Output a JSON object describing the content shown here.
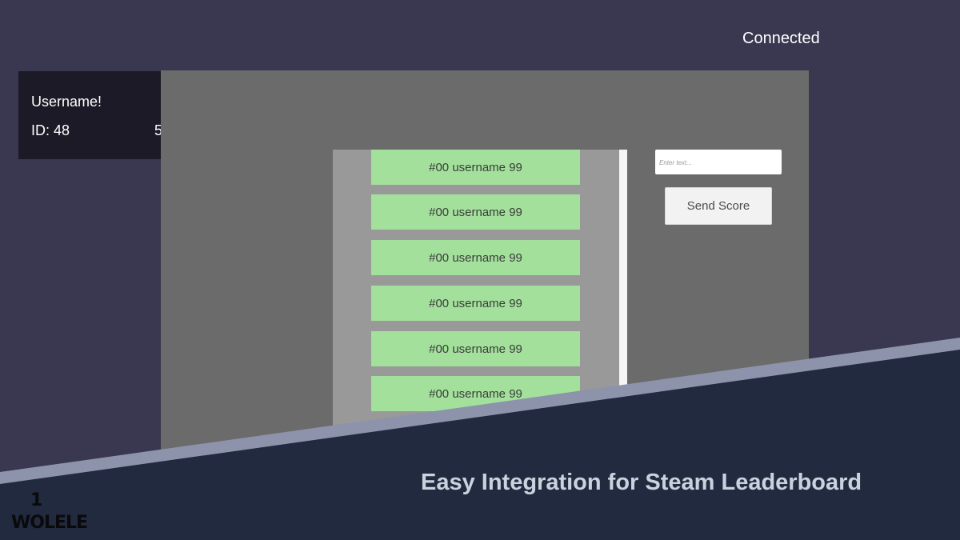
{
  "status": {
    "connection": "Connected"
  },
  "user": {
    "name": "Username!",
    "id": "ID: 48",
    "extra": "5"
  },
  "leaderboard": {
    "rows": [
      {
        "label": "#00 username 99"
      },
      {
        "label": "#00 username 99"
      },
      {
        "label": "#00 username 99"
      },
      {
        "label": "#00 username 99"
      },
      {
        "label": "#00 username 99"
      },
      {
        "label": "#00 username 99"
      }
    ]
  },
  "score_form": {
    "placeholder": "Enter text...",
    "value": "",
    "send_label": "Send Score"
  },
  "banner": {
    "caption": "Easy Integration for Steam Leaderboard"
  },
  "logo": {
    "mark": "1",
    "text": "WOLELE"
  },
  "colors": {
    "background": "#3a3750",
    "panel": "#6b6b6b",
    "row": "#a2e09b",
    "banner": "#222a40",
    "stripe": "#8c93aa"
  }
}
